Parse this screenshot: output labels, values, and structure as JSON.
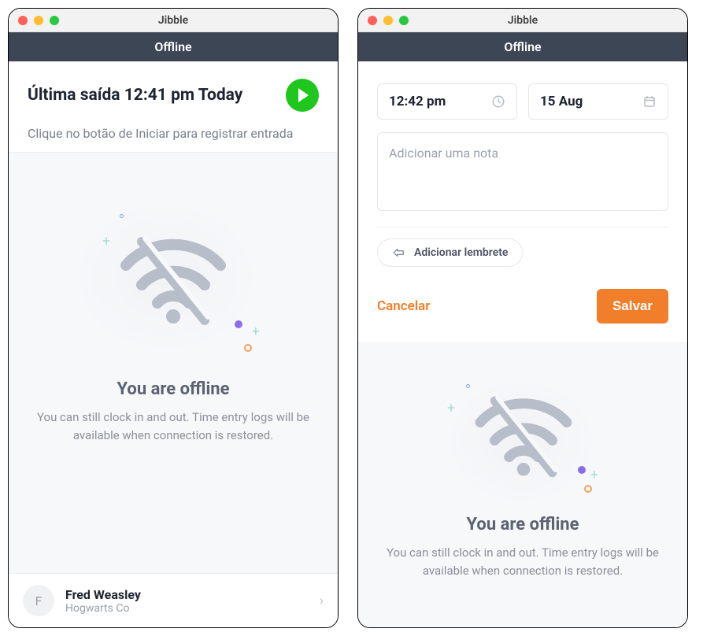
{
  "app_title": "Jibble",
  "status_label": "Offline",
  "window1": {
    "last_out": "Última saída 12:41 pm Today",
    "instruction": "Clique no botão de Iniciar para registrar entrada",
    "offline_heading": "You are offline",
    "offline_body": "You can still clock in and out. Time entry logs will be available when connection is restored.",
    "user": {
      "initial": "F",
      "name": "Fred Weasley",
      "org": "Hogwarts Co"
    }
  },
  "window2": {
    "time_value": "12:42 pm",
    "date_value": "15 Aug",
    "note_placeholder": "Adicionar uma nota",
    "reminder_label": "Adicionar lembrete",
    "cancel_label": "Cancelar",
    "save_label": "Salvar",
    "offline_heading": "You are offline",
    "offline_body": "You can still clock in and out. Time entry logs will be available when connection is restored."
  }
}
